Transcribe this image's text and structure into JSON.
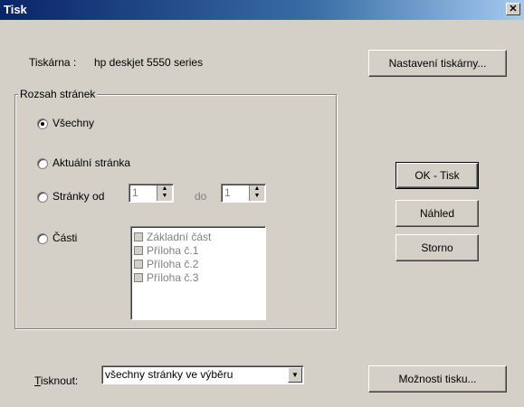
{
  "window": {
    "title": "Tisk",
    "close_label": "✕"
  },
  "printer": {
    "label": "Tiskárna :",
    "name": "hp deskjet 5550 series",
    "settings_button": "Nastavení tiskárny..."
  },
  "range": {
    "title": "Rozsah stránek",
    "all": "Všechny",
    "current": "Aktuální stránka",
    "pages_from": "Stránky od",
    "from_value": "1",
    "to_label": "do",
    "to_value": "1",
    "parts": "Části",
    "parts_list": [
      "Základní část",
      "Příloha č.1",
      "Příloha č.2",
      "Příloha č.3"
    ]
  },
  "buttons": {
    "ok": "OK - Tisk",
    "preview": "Náhled",
    "cancel": "Storno",
    "options": "Možnosti tisku..."
  },
  "print": {
    "label_first": "T",
    "label_rest": "isknout:",
    "value": "všechny stránky ve výběru"
  }
}
